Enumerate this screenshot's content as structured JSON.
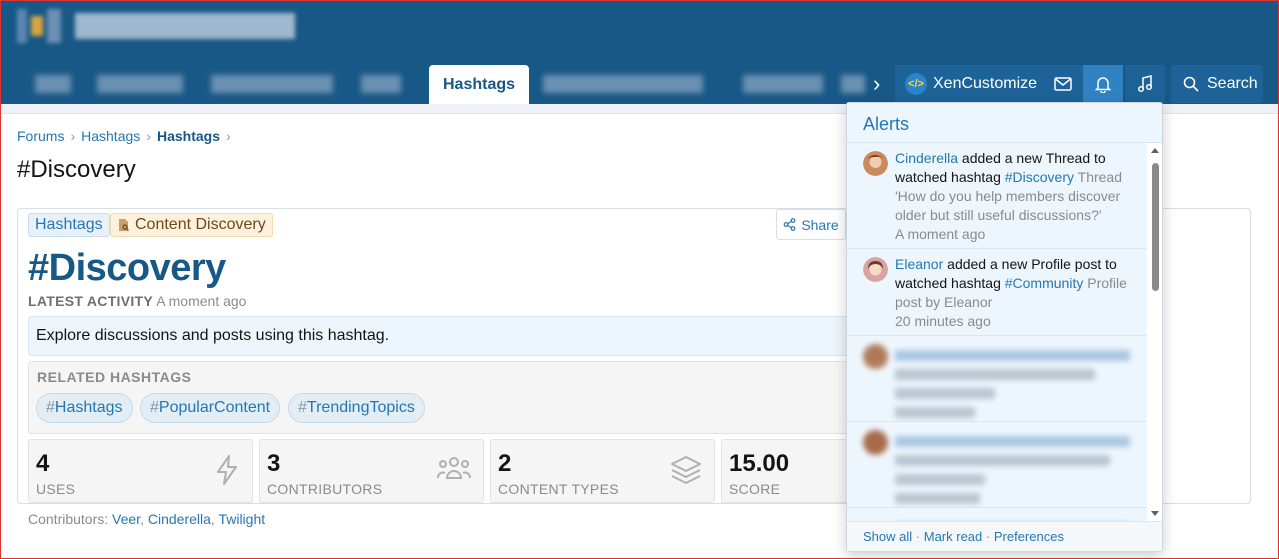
{
  "nav": {
    "active_tab": "Hashtags",
    "xencustomize_label": "XenCustomize",
    "search_label": "Search",
    "xc_icon_text": "</>"
  },
  "breadcrumb": [
    "Forums",
    "Hashtags",
    "Hashtags"
  ],
  "page_title": "#Discovery",
  "tags": {
    "forum_tag": "Hashtags",
    "category_tag": "Content Discovery"
  },
  "share_label": "Share",
  "hashtag_heading": "#Discovery",
  "latest_activity": {
    "label": "LATEST ACTIVITY",
    "value": "A moment ago"
  },
  "description": "Explore discussions and posts using this hashtag.",
  "related": {
    "title": "RELATED HASHTAGS",
    "hash": "#",
    "items": [
      "Hashtags",
      "PopularContent",
      "TrendingTopics"
    ]
  },
  "stats": [
    {
      "value": "4",
      "label": "USES",
      "icon": "bolt-icon"
    },
    {
      "value": "3",
      "label": "CONTRIBUTORS",
      "icon": "users-icon"
    },
    {
      "value": "2",
      "label": "CONTENT TYPES",
      "icon": "layers-icon"
    },
    {
      "value": "15.00",
      "label": "SCORE",
      "icon": ""
    }
  ],
  "contributors": {
    "label": "Contributors:",
    "names": [
      "Veer",
      "Cinderella",
      "Twilight"
    ]
  },
  "alerts": {
    "title": "Alerts",
    "items": [
      {
        "user": "Cinderella",
        "text1": " added a new Thread to watched hashtag ",
        "tag": "#Discovery",
        "text2": " Thread 'How do you help members discover older but still useful discussions?'",
        "time": "A moment ago"
      },
      {
        "user": "Eleanor",
        "text1": " added a new Profile post to watched hashtag ",
        "tag": "#Community",
        "text2": " Profile post by Eleanor",
        "time": "20 minutes ago"
      }
    ],
    "footer": {
      "show_all": "Show all",
      "mark_read": "Mark read",
      "preferences": "Preferences",
      "separator": "·"
    }
  }
}
